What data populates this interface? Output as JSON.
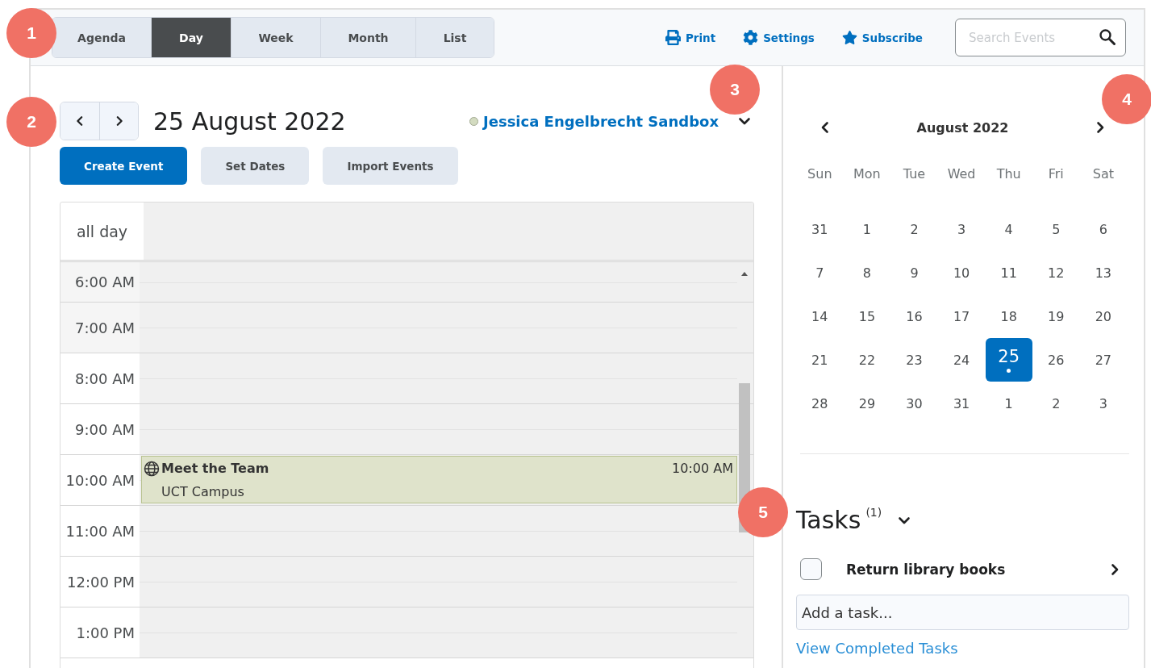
{
  "view_tabs": [
    {
      "label": "Agenda",
      "selected": false
    },
    {
      "label": "Day",
      "selected": true
    },
    {
      "label": "Week",
      "selected": false
    },
    {
      "label": "Month",
      "selected": false
    },
    {
      "label": "List",
      "selected": false
    }
  ],
  "toolbar_links": [
    {
      "kind": "print",
      "label": "Print"
    },
    {
      "kind": "settings",
      "label": "Settings"
    },
    {
      "kind": "subscribe",
      "label": "Subscribe"
    }
  ],
  "search": {
    "placeholder": "Search Events"
  },
  "date_title": "25 August 2022",
  "calendar_source": {
    "name": "Jessica Engelbrecht Sandbox",
    "color": "#d3dbc0"
  },
  "actions": [
    {
      "label": "Create Event",
      "primary": true
    },
    {
      "label": "Set Dates",
      "primary": false
    },
    {
      "label": "Import Events",
      "primary": false
    }
  ],
  "all_day_label": "all day",
  "hours": [
    {
      "label": "6:00 AM"
    },
    {
      "label": "7:00 AM"
    },
    {
      "label": "8:00 AM"
    },
    {
      "label": "9:00 AM"
    },
    {
      "label": "10:00 AM",
      "event": {
        "title": "Meet the Team",
        "location": "UCT Campus",
        "time": "10:00 AM"
      }
    },
    {
      "label": "11:00 AM"
    },
    {
      "label": "12:00 PM"
    },
    {
      "label": "1:00 PM"
    }
  ],
  "mini_calendar": {
    "title": "August 2022",
    "weekdays": [
      "Sun",
      "Mon",
      "Tue",
      "Wed",
      "Thu",
      "Fri",
      "Sat"
    ],
    "weeks": [
      [
        {
          "day": "31",
          "selected": false,
          "has_event": false
        },
        {
          "day": "1",
          "selected": false,
          "has_event": false
        },
        {
          "day": "2",
          "selected": false,
          "has_event": false
        },
        {
          "day": "3",
          "selected": false,
          "has_event": false
        },
        {
          "day": "4",
          "selected": false,
          "has_event": false
        },
        {
          "day": "5",
          "selected": false,
          "has_event": false
        },
        {
          "day": "6",
          "selected": false,
          "has_event": false
        }
      ],
      [
        {
          "day": "7",
          "selected": false,
          "has_event": false
        },
        {
          "day": "8",
          "selected": false,
          "has_event": false
        },
        {
          "day": "9",
          "selected": false,
          "has_event": false
        },
        {
          "day": "10",
          "selected": false,
          "has_event": false
        },
        {
          "day": "11",
          "selected": false,
          "has_event": false
        },
        {
          "day": "12",
          "selected": false,
          "has_event": false
        },
        {
          "day": "13",
          "selected": false,
          "has_event": false
        }
      ],
      [
        {
          "day": "14",
          "selected": false,
          "has_event": false
        },
        {
          "day": "15",
          "selected": false,
          "has_event": false
        },
        {
          "day": "16",
          "selected": false,
          "has_event": false
        },
        {
          "day": "17",
          "selected": false,
          "has_event": false
        },
        {
          "day": "18",
          "selected": false,
          "has_event": false
        },
        {
          "day": "19",
          "selected": false,
          "has_event": false
        },
        {
          "day": "20",
          "selected": false,
          "has_event": false
        }
      ],
      [
        {
          "day": "21",
          "selected": false,
          "has_event": false
        },
        {
          "day": "22",
          "selected": false,
          "has_event": false
        },
        {
          "day": "23",
          "selected": false,
          "has_event": false
        },
        {
          "day": "24",
          "selected": false,
          "has_event": false
        },
        {
          "day": "25",
          "selected": true,
          "has_event": true
        },
        {
          "day": "26",
          "selected": false,
          "has_event": false
        },
        {
          "day": "27",
          "selected": false,
          "has_event": false
        }
      ],
      [
        {
          "day": "28",
          "selected": false,
          "has_event": false
        },
        {
          "day": "29",
          "selected": false,
          "has_event": false
        },
        {
          "day": "30",
          "selected": false,
          "has_event": false
        },
        {
          "day": "31",
          "selected": false,
          "has_event": false
        },
        {
          "day": "1",
          "selected": false,
          "has_event": false
        },
        {
          "day": "2",
          "selected": false,
          "has_event": false
        },
        {
          "day": "3",
          "selected": false,
          "has_event": false
        }
      ]
    ]
  },
  "tasks": {
    "title": "Tasks",
    "count": "(1)",
    "items": [
      {
        "label": "Return library books",
        "checked": false
      }
    ],
    "add_placeholder": "Add a task...",
    "link": "View Completed Tasks"
  },
  "annotations": [
    "1",
    "2",
    "3",
    "4",
    "5"
  ]
}
